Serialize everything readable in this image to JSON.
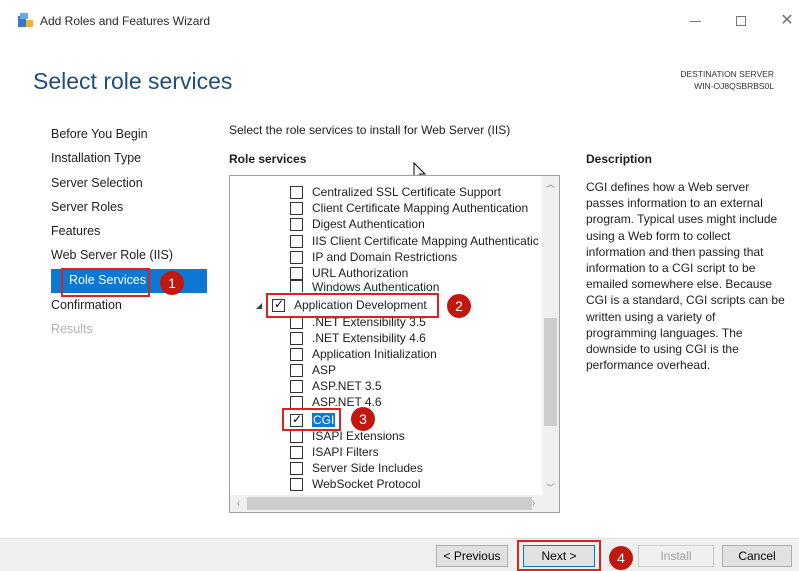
{
  "window": {
    "title": "Add Roles and Features Wizard",
    "controls": [
      "minimize-icon",
      "maximize-icon",
      "close-icon"
    ]
  },
  "header": {
    "page_title": "Select role services",
    "destination_label": "DESTINATION SERVER",
    "destination_server": "WIN-OJ8QSBRBS0L"
  },
  "sidebar": {
    "items": [
      {
        "label": "Before You Begin",
        "state": "normal"
      },
      {
        "label": "Installation Type",
        "state": "normal"
      },
      {
        "label": "Server Selection",
        "state": "normal"
      },
      {
        "label": "Server Roles",
        "state": "normal"
      },
      {
        "label": "Features",
        "state": "normal"
      },
      {
        "label": "Web Server Role (IIS)",
        "state": "normal"
      },
      {
        "label": "Role Services",
        "state": "active"
      },
      {
        "label": "Confirmation",
        "state": "normal"
      },
      {
        "label": "Results",
        "state": "disabled"
      }
    ]
  },
  "main": {
    "instruction": "Select the role services to install for Web Server (IIS)",
    "role_services_heading": "Role services",
    "tree": [
      {
        "label": "Centralized SSL Certificate Support",
        "checked": false
      },
      {
        "label": "Client Certificate Mapping Authentication",
        "checked": false
      },
      {
        "label": "Digest Authentication",
        "checked": false
      },
      {
        "label": "IIS Client Certificate Mapping Authenticatic",
        "checked": false
      },
      {
        "label": "IP and Domain Restrictions",
        "checked": false
      },
      {
        "label": "URL Authorization",
        "checked": false
      },
      {
        "label": "Windows Authentication",
        "checked": false
      },
      {
        "label": "Application Development",
        "checked": true
      },
      {
        "label": ".NET Extensibility 3.5",
        "checked": false
      },
      {
        "label": ".NET Extensibility 4.6",
        "checked": false
      },
      {
        "label": "Application Initialization",
        "checked": false
      },
      {
        "label": "ASP",
        "checked": false
      },
      {
        "label": "ASP.NET 3.5",
        "checked": false
      },
      {
        "label": "ASP.NET 4.6",
        "checked": false
      },
      {
        "label": "CGI",
        "checked": true
      },
      {
        "label": "ISAPI Extensions",
        "checked": false
      },
      {
        "label": "ISAPI Filters",
        "checked": false
      },
      {
        "label": "Server Side Includes",
        "checked": false
      },
      {
        "label": "WebSocket Protocol",
        "checked": false
      }
    ]
  },
  "description": {
    "heading": "Description",
    "text": "CGI defines how a Web server passes information to an external program. Typical uses might include using a Web form to collect information and then passing that information to a CGI script to be emailed somewhere else. Because CGI is a standard, CGI scripts can be written using a variety of programming languages. The downside to using CGI is the performance overhead."
  },
  "annotations": [
    "1",
    "2",
    "3",
    "4"
  ],
  "footer": {
    "previous": "< Previous",
    "next": "Next >",
    "install": "Install",
    "cancel": "Cancel"
  },
  "colors": {
    "accent": "#0c78d4",
    "title": "#1f4e79",
    "annotation_red": "#e0201a",
    "badge_red": "#c0180f"
  }
}
